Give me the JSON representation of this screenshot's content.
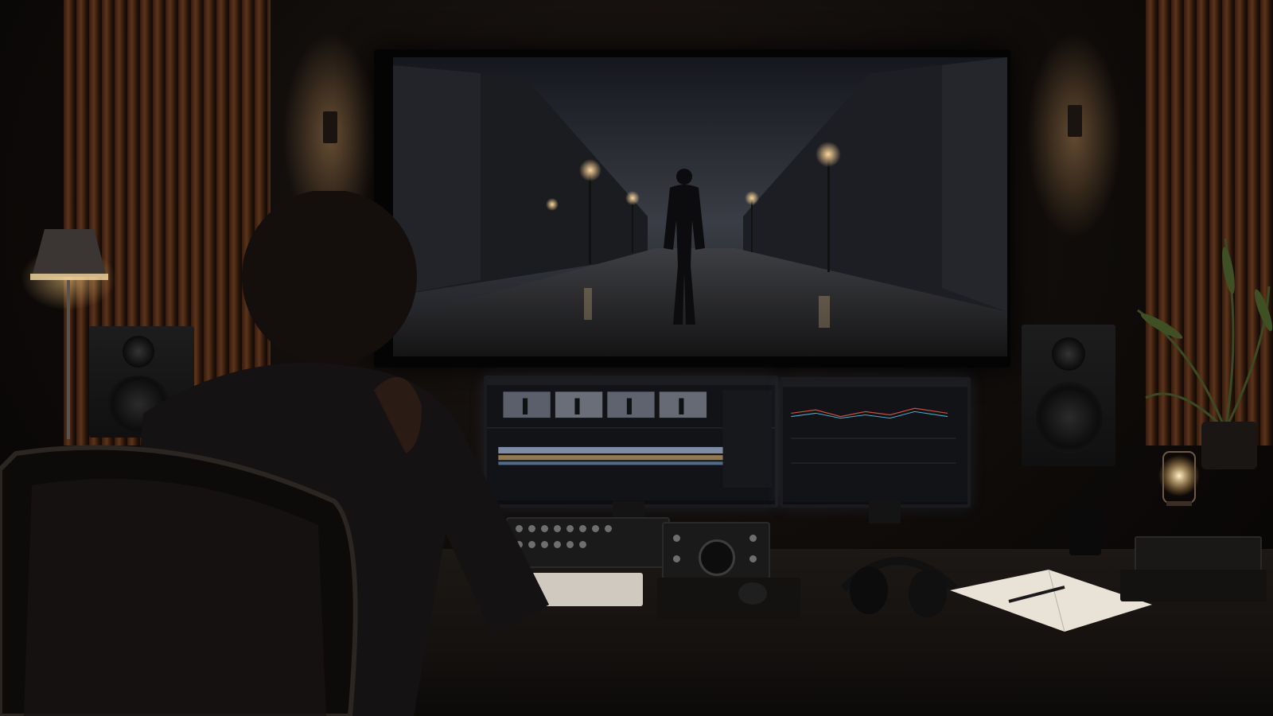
{
  "scene": {
    "description_colors": {
      "wall": "#0e0b09",
      "wood_slats": "#6b3b1c",
      "lamp_light": "#ffcf86",
      "screen_fog": "#3a3d45"
    }
  },
  "icons": [
    "floor-lamp-icon",
    "speaker-icon",
    "headphones-icon",
    "mug-icon",
    "candle-icon",
    "plant-icon",
    "keyboard-icon",
    "mouse-icon",
    "notebook-icon"
  ]
}
